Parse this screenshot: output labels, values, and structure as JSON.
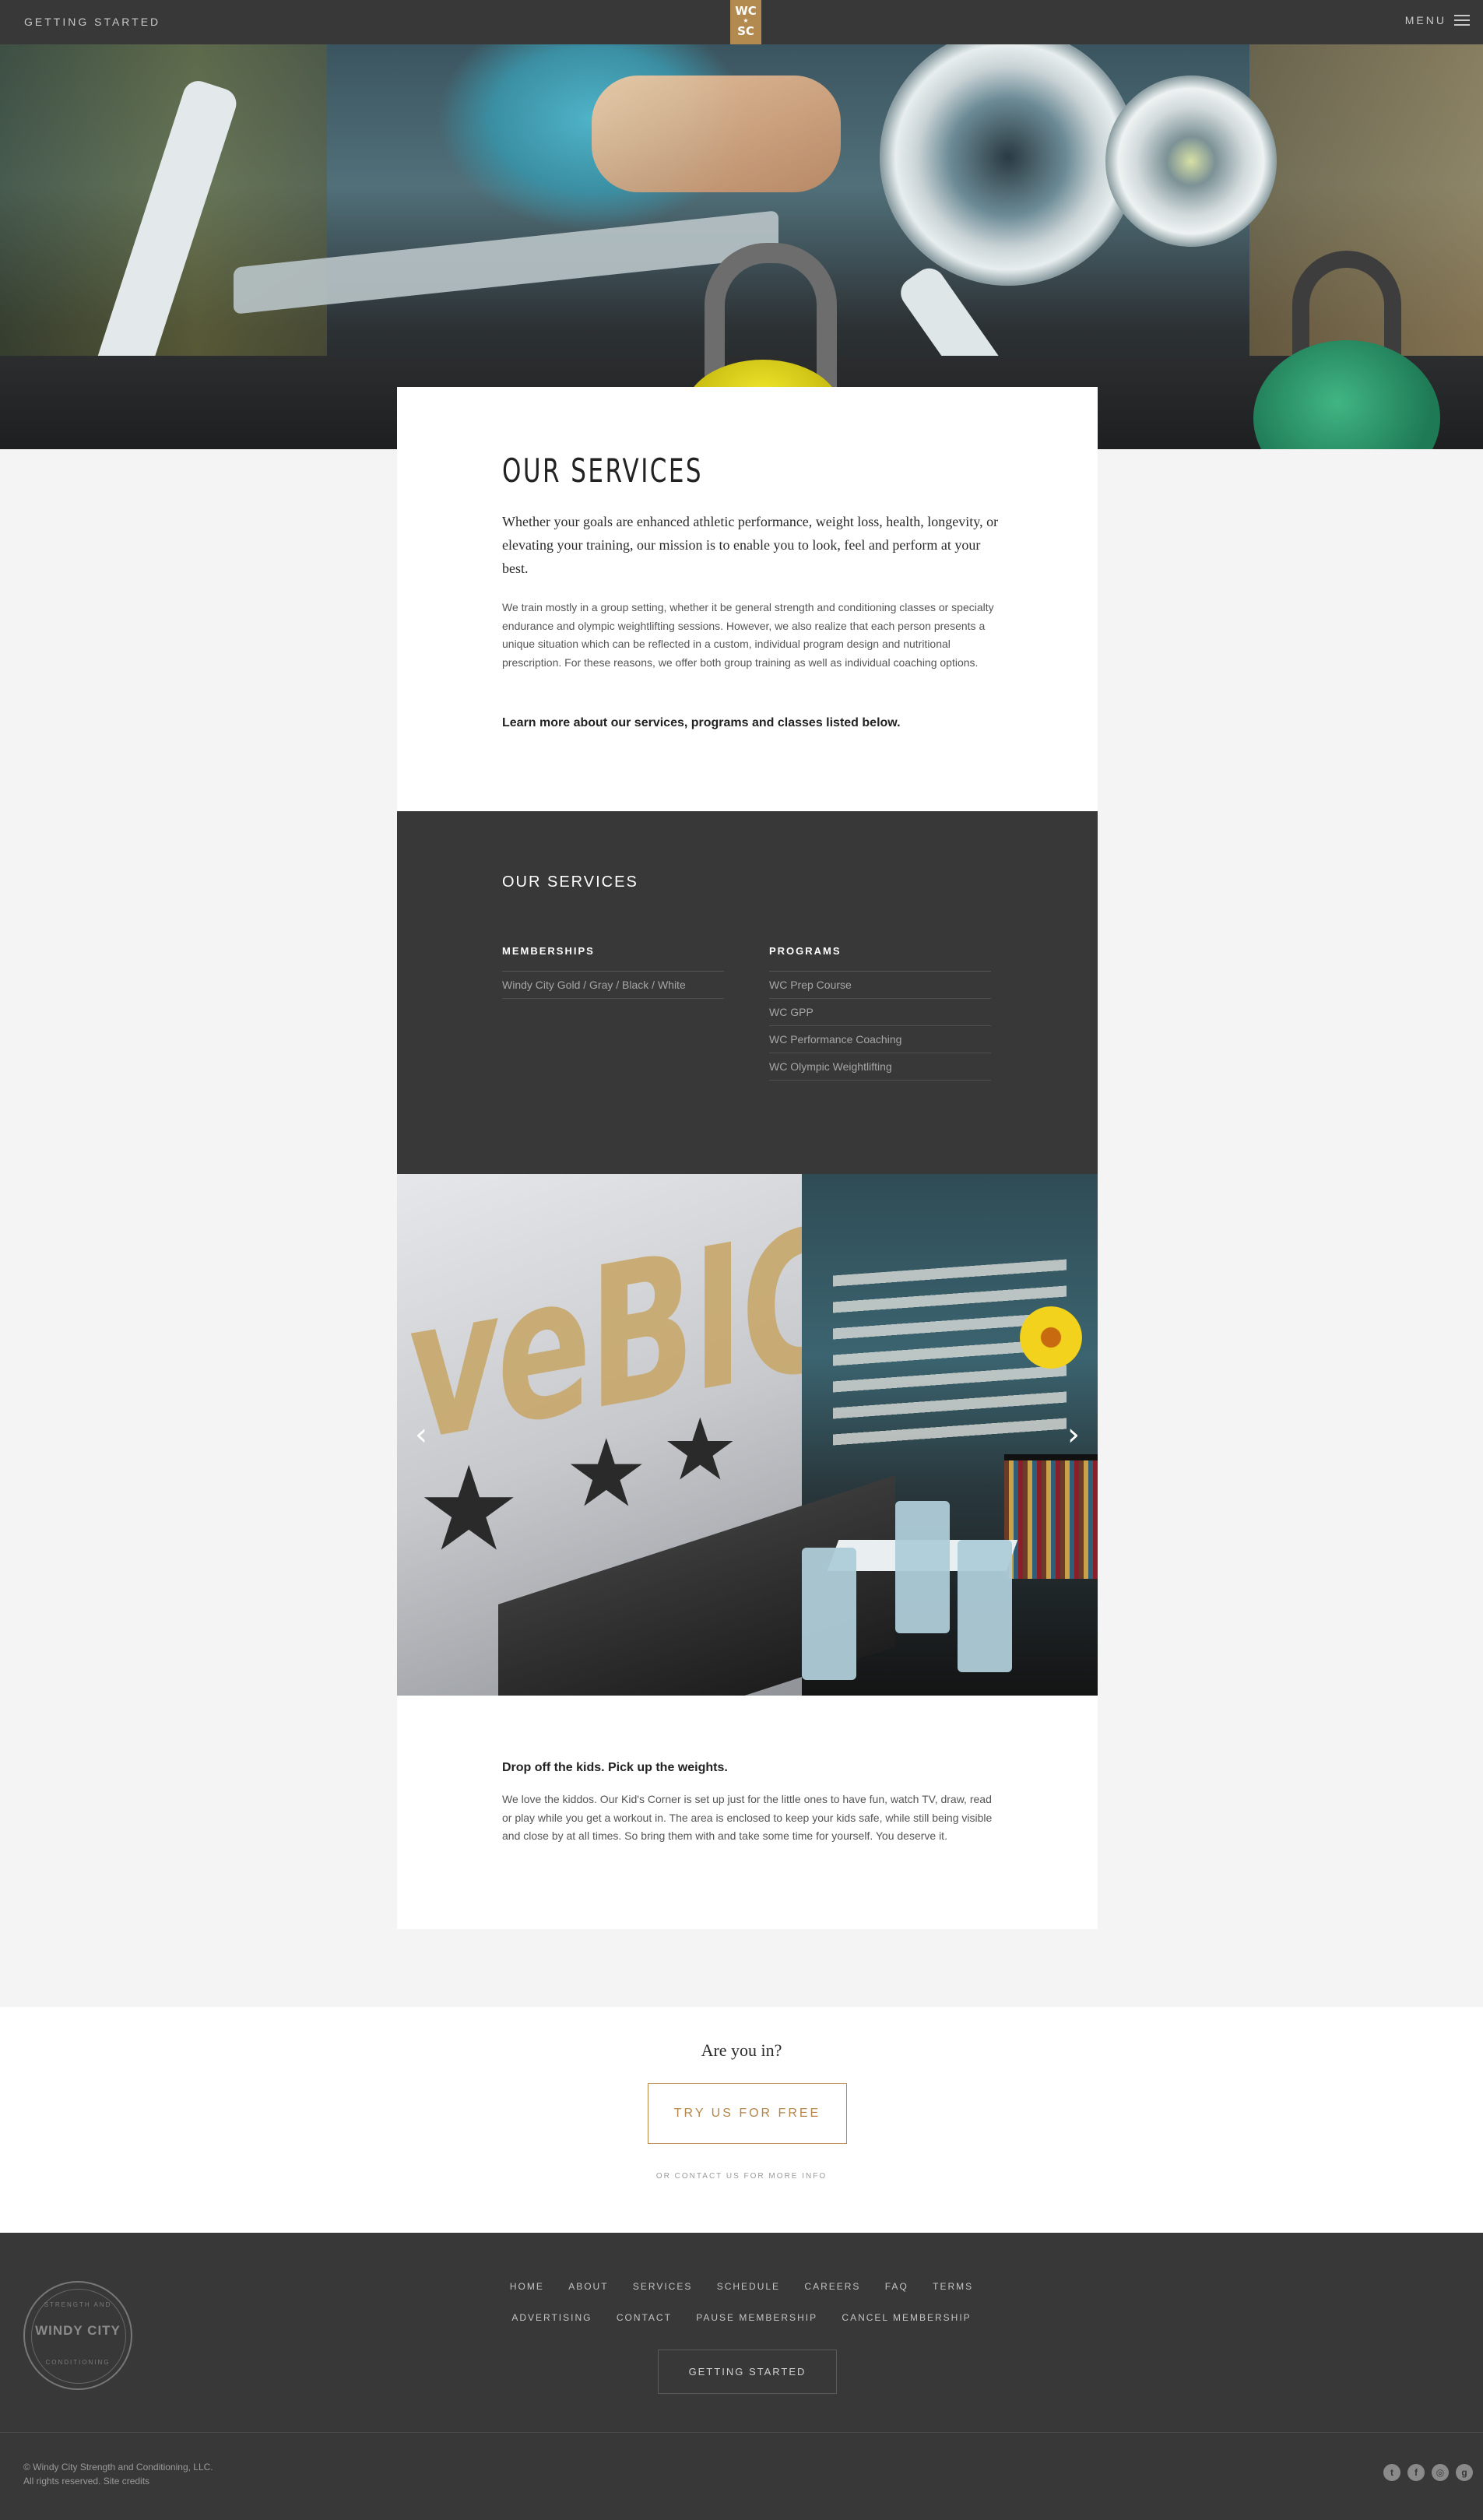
{
  "header": {
    "getting_started": "GETTING STARTED",
    "logo_top": "WC",
    "logo_star": "★",
    "logo_bottom": "SC",
    "menu_label": "MENU"
  },
  "intro": {
    "title": "OUR SERVICES",
    "lead": "Whether your goals are enhanced athletic performance, weight loss, health, longevity, or elevating your training, our mission is to enable you to look, feel and perform at your best.",
    "body": "We train mostly in a group setting, whether it be general strength and conditioning classes or specialty endurance and olympic weightlifting sessions. However, we also realize that each person presents a unique situation which can be reflected in a custom, individual program design and nutritional prescription. For these reasons, we offer both group training as well as individual coaching options.",
    "cta": "Learn more about our services, programs and classes listed below."
  },
  "services": {
    "heading": "OUR SERVICES",
    "memberships": {
      "heading": "MEMBERSHIPS",
      "items": [
        "Windy City Gold / Gray / Black / White"
      ]
    },
    "programs": {
      "heading": "PROGRAMS",
      "items": [
        "WC Prep Course",
        "WC GPP",
        "WC Performance Coaching",
        "WC Olympic Weightlifting"
      ]
    }
  },
  "slider": {
    "wall_text": "veBIG",
    "prev_icon": "‹",
    "next_icon": "›"
  },
  "kids": {
    "title": "Drop off the kids. Pick up the weights.",
    "body": "We love the kiddos. Our Kid's Corner is set up just for the little ones to have fun, watch TV, draw, read or play while you get a workout in. The area is enclosed to keep your kids safe, while still being visible and close by at all times. So bring them with and take some time for yourself. You deserve it."
  },
  "cta_section": {
    "question": "Are you in?",
    "button": "TRY US FOR FREE",
    "contact": "OR CONTACT US FOR MORE INFO"
  },
  "footer": {
    "badge_top": "STRENGTH AND",
    "badge_main": "WINDY CITY",
    "badge_bottom": "CONDITIONING",
    "nav_row1": [
      "HOME",
      "ABOUT",
      "SERVICES",
      "SCHEDULE",
      "CAREERS",
      "FAQ",
      "TERMS"
    ],
    "nav_row2": [
      "ADVERTISING",
      "CONTACT",
      "PAUSE MEMBERSHIP",
      "CANCEL MEMBERSHIP"
    ],
    "getting_started": "GETTING STARTED",
    "copyright_line1": "© Windy City Strength and Conditioning, LLC.",
    "copyright_line2": "All rights reserved. Site credits",
    "social": [
      "t",
      "f",
      "◎",
      "g"
    ]
  }
}
